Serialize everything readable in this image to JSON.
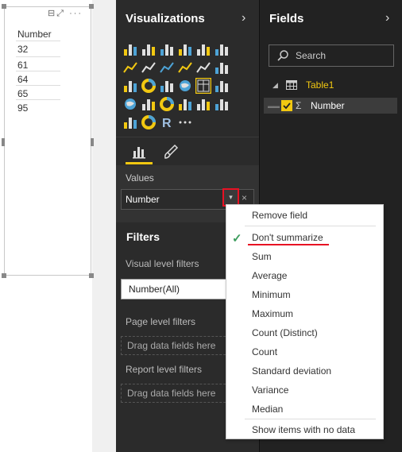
{
  "report": {
    "visual_toolbar": "⊟⤢ ···",
    "table": {
      "header": "Number",
      "rows": [
        "32",
        "61",
        "64",
        "65",
        "95"
      ]
    }
  },
  "visualizations": {
    "title": "Visualizations",
    "chevron": "›",
    "icons": [
      "stacked-bar-icon",
      "stacked-column-icon",
      "clustered-bar-icon",
      "clustered-column-icon",
      "percent-bar-icon",
      "percent-column-icon",
      "line-chart-icon",
      "area-chart-icon",
      "stacked-area-icon",
      "line-column-icon",
      "line-clustered-column-icon",
      "ribbon-chart-icon",
      "scatter-chart-icon",
      "pie-chart-icon",
      "treemap-icon",
      "map-icon",
      "table-visual-icon",
      "matrix-icon",
      "filled-map-icon",
      "funnel-icon",
      "gauge-icon",
      "multi-row-card-icon",
      "card-icon",
      "kpi-icon",
      "slicer-icon",
      "donut-chart-icon",
      "r-script-icon",
      "more-visuals-icon"
    ],
    "values_label": "Values",
    "value_field": "Number",
    "dropdown_glyph": "▾",
    "remove_glyph": "×"
  },
  "filters": {
    "title": "Filters",
    "visual_level": "Visual level filters",
    "visual_filter_card": "Number(All)",
    "page_level": "Page level filters",
    "page_drop": "Drag data fields here",
    "report_level": "Report level filters",
    "report_drop": "Drag data fields here"
  },
  "fields": {
    "title": "Fields",
    "chevron": "›",
    "search_placeholder": "Search",
    "table_name": "Table1",
    "field_name": "Number",
    "field_sigma": "Σ",
    "expand_glyph": "◢"
  },
  "menu": {
    "items": [
      "Remove field",
      "Don't summarize",
      "Sum",
      "Average",
      "Minimum",
      "Maximum",
      "Count (Distinct)",
      "Count",
      "Standard deviation",
      "Variance",
      "Median",
      "Show items with no data"
    ],
    "selected_index": 1,
    "check_glyph": "✓"
  },
  "colors": {
    "accent": "#f2c811",
    "highlight_red": "#e81123",
    "check_green": "#3c9d5d"
  }
}
